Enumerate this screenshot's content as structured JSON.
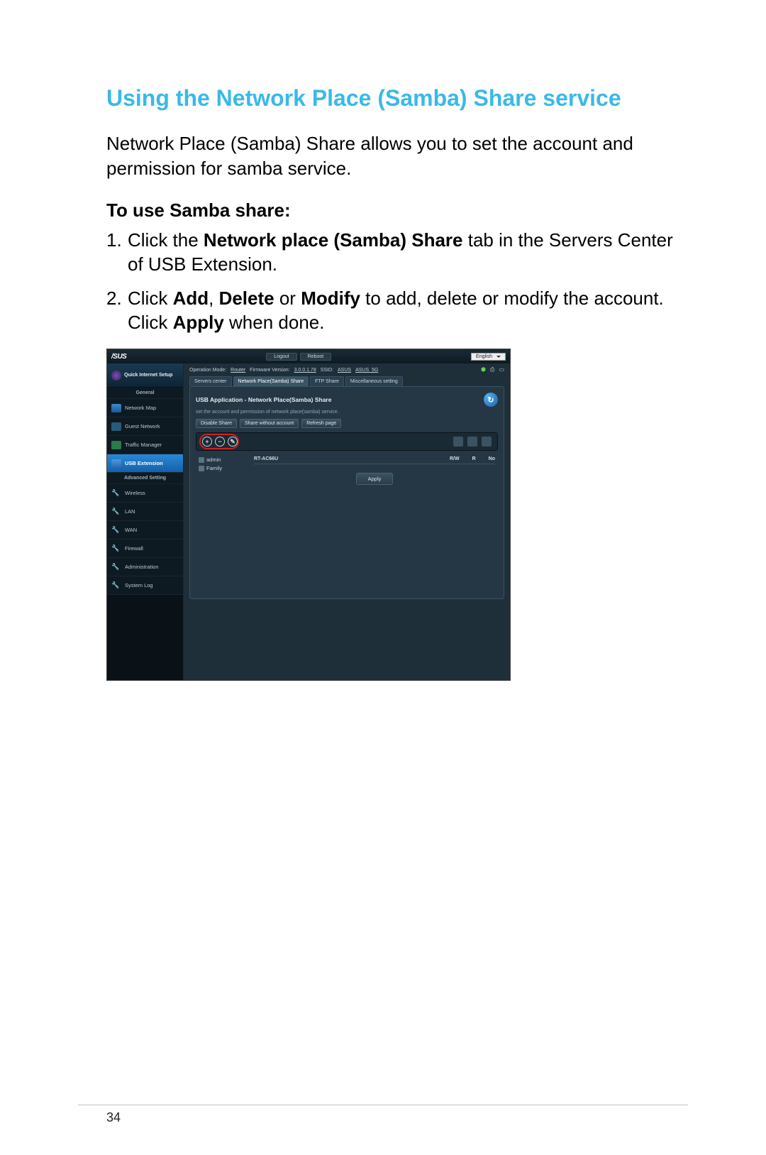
{
  "doc": {
    "title": "Using the Network Place (Samba) Share service",
    "intro": "Network Place (Samba) Share allows you to set the account and permission for samba service.",
    "subtitle": "To use Samba share:",
    "step1_num": "1.",
    "step1_a": "Click the ",
    "step1_b": "Network place (Samba) Share",
    "step1_c": " tab in the Servers Center of USB Extension.",
    "step2_num": "2.",
    "step2_a": "Click ",
    "step2_b": "Add",
    "step2_c": ", ",
    "step2_d": "Delete",
    "step2_e": " or ",
    "step2_f": "Modify",
    "step2_g": " to add, delete or modify the account. Click ",
    "step2_h": "Apply",
    "step2_i": " when done.",
    "page_number": "34"
  },
  "shot": {
    "brand": "/SUS",
    "logout": "Logout",
    "reboot": "Reboot",
    "language": "English",
    "qis": "Quick Internet Setup",
    "section_general": "General",
    "nav": {
      "map": "Network Map",
      "guest": "Guest Network",
      "traffic": "Traffic Manager",
      "usb": "USB Extension"
    },
    "section_advanced": "Advanced Setting",
    "adv": {
      "wireless": "Wireless",
      "lan": "LAN",
      "wan": "WAN",
      "firewall": "Firewall",
      "admin": "Administration",
      "syslog": "System Log"
    },
    "info": {
      "opmode_label": "Operation Mode:",
      "opmode": "Router",
      "fw_label": "Firmware Version:",
      "fw": "3.0.0.1.78",
      "ssid_label": "SSID:",
      "ssid1": "ASUS",
      "ssid2": "ASUS_5G"
    },
    "tabs": {
      "servers": "Servers center",
      "samba": "Network Place(Samba) Share",
      "ftp": "FTP Share",
      "misc": "Miscellaneous setting"
    },
    "panel": {
      "title": "USB Application - Network Place(Samba) Share",
      "desc": "set the account and permission of network place(samba) service.",
      "disable": "Disable Share",
      "share_wo": "Share without account",
      "refresh": "Refresh page",
      "add": "+",
      "del": "−",
      "mod": "✎",
      "user_admin": "admin",
      "user_family": "Family",
      "device": "RT-AC66U",
      "rw": "R/W",
      "r": "R",
      "no": "No",
      "apply": "Apply"
    }
  }
}
